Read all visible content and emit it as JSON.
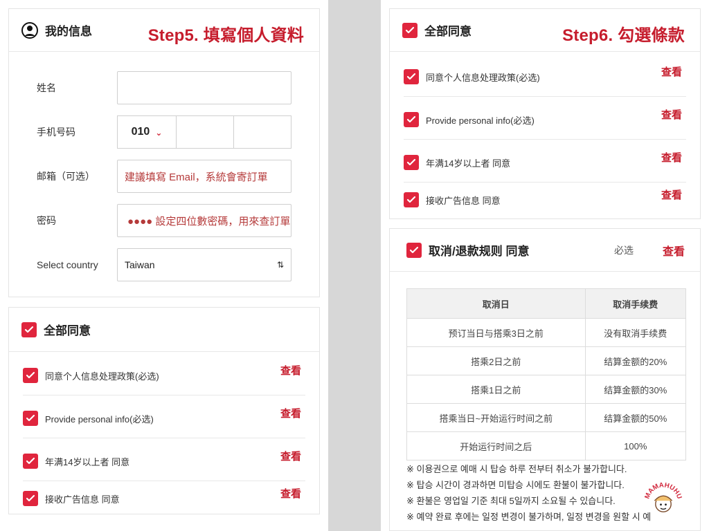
{
  "left": {
    "info_card": {
      "title": "我的信息",
      "step": "Step5. 填寫個人資料",
      "fields": [
        {
          "label": "姓名",
          "value": ""
        },
        {
          "label": "手机号码",
          "value": "010"
        },
        {
          "label": "邮箱（可选）",
          "value": "建議填寫 Email，系統會寄訂單"
        },
        {
          "label": "密码",
          "value": "●●●●  設定四位數密碼，用來查訂單用"
        },
        {
          "label": "Select country",
          "value": "Taiwan"
        }
      ]
    },
    "agree_card": {
      "title": "全部同意",
      "items": [
        {
          "text": "同意个人信息处理政策(必选)",
          "action": "查看"
        },
        {
          "text": "Provide personal info(必选)",
          "action": "查看"
        },
        {
          "text": "年满14岁以上者 同意",
          "action": "查看"
        },
        {
          "text": "接收广告信息 同意",
          "action": "查看"
        }
      ]
    }
  },
  "right": {
    "agree_card": {
      "title": "全部同意",
      "step": "Step6. 勾選條款",
      "items": [
        {
          "text": "同意个人信息处理政策(必选)",
          "action": "查看"
        },
        {
          "text": "Provide personal info(必选)",
          "action": "查看"
        },
        {
          "text": "年满14岁以上者 同意",
          "action": "查看"
        },
        {
          "text": "接收广告信息 同意",
          "action": "查看"
        }
      ]
    },
    "rules_card": {
      "title": "取消/退款规则 同意",
      "required": "必选",
      "view": "查看",
      "table": {
        "headers": [
          "取消日",
          "取消手续费"
        ],
        "rows": [
          [
            "预订当日与搭乘3日之前",
            "没有取消手续费"
          ],
          [
            "搭乘2日之前",
            "结算金额的20%"
          ],
          [
            "搭乘1日之前",
            "结算金额的30%"
          ],
          [
            "搭乘当日~开始运行时间之前",
            "结算金额的50%"
          ],
          [
            "开始运行时间之后",
            "100%"
          ]
        ]
      },
      "notes": [
        "※ 이용권으로 예매 시 탑승 하루 전부터 취소가 불가합니다.",
        "※ 탑승 시간이 경과하면 미탑승 시에도 환불이 불가합니다.",
        "※ 환불은 영업일 기준 최대 5일까지 소요될 수 있습니다.",
        "※ 예약 완료 후에는 일정 변경이 불가하며, 일정 변경을 원할 시 예"
      ]
    }
  },
  "colors": {
    "accent": "#e0253d",
    "step_text": "#c61d2d",
    "gutter": "#d7d7d7"
  },
  "watermark": "MAMAHUHU"
}
